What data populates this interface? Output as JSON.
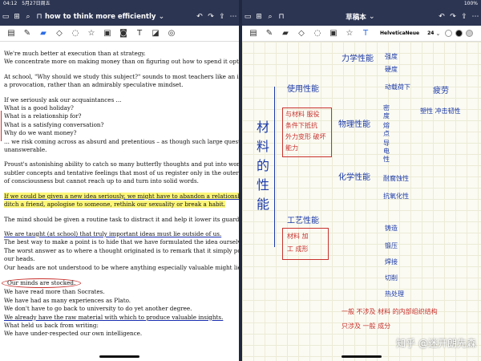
{
  "status": {
    "time": "04:12",
    "date": "5月27日周五",
    "battery": "100%"
  },
  "left": {
    "title": "how to think more efficiently",
    "title_chevron": "⌄",
    "paragraphs": [
      [
        "We're much better at execution than at strategy.",
        "We concentrate more on making money than on figuring out how to spend it optimally."
      ],
      [
        "At school, \"Why should we study this subject?\" sounds to most teachers like an insult and",
        "a provocation, rather than an admirably speculative mindset."
      ],
      [
        "If we seriously ask our acquaintances ...",
        "What is a good holiday?",
        "What is a relationship for?",
        "What is a satisfying conversation?",
        "Why do we want money?",
        "... we risk coming across as absurd and pretentious – as though such large questions were",
        "unanswerable."
      ],
      [
        "Proust's astonishing ability to catch so many butterfly thoughts and put into words the",
        "subtler concepts and tentative feelings that most of us register only in the outer airy zones",
        "of consciousness but cannot reach up to and turn into solid words."
      ],
      [
        "If we could be given a new idea seriously, we might have to abandon a relationship, leave a job,",
        "ditch a friend, apologise to someone, rethink our sexuality or break a habit."
      ],
      [
        "The mind should be given a routine task to distract it and help it lower its guard."
      ],
      [
        "We are taught (at school) that truly important ideas must lie outside of us.",
        "The best way to make a point is to hide that we have formulated the idea ourselves.",
        "The worst answer as to where a thought originated is to remark that it simply popped into",
        "our heads.",
        "Our heads are not understood to be where anything especially valuable might lie."
      ],
      [
        "Our minds are stocked.",
        "We have read more than Socrates.",
        "We have had as many experiences as Plato.",
        "We don't have to go back to university to do yet another degree.",
        "We already have the raw material with which to produce valuable insights.",
        "What held us back from writing:",
        "We have under-respected our own intelligence."
      ]
    ]
  },
  "right": {
    "title": "草稿本",
    "title_chevron": "⌄",
    "font_name": "HelveticaNeue",
    "font_size": "24",
    "font_chevron": "⌄",
    "handwriting": {
      "main_vertical": [
        "材",
        "料",
        "的",
        "性",
        "能"
      ],
      "use_performance": "使用性能",
      "process_performance": "工艺性能",
      "mechanical": "力学性能",
      "hardness": "强度",
      "stiffness": "硬度",
      "fatigue": "疲劳",
      "dynamic_strength": "动载荷下",
      "plasticity": "塑性 冲击韧性",
      "physical": "物理性能",
      "phys_items": [
        "密",
        "度",
        "熔",
        "点",
        "导",
        "电",
        "性"
      ],
      "chemical": "化学性能",
      "corrosion": "耐腐蚀性",
      "oxidation": "抗氧化性",
      "note_red_box1": [
        "与材料 服役",
        "条件下抵抗",
        "外力变形 破坏",
        "能力"
      ],
      "note_red_box2": [
        "材料 加",
        "工 成形"
      ],
      "casting": "铸造",
      "forging": "锻压",
      "welding": "焊接",
      "cutting": "切削",
      "heat_treatment": "热处理",
      "bottom_note": [
        "一般 不涉及 材料 的内部组织结构",
        "只涉及 一般 成分"
      ]
    },
    "watermark": "知乎 @迷开朗先森"
  }
}
